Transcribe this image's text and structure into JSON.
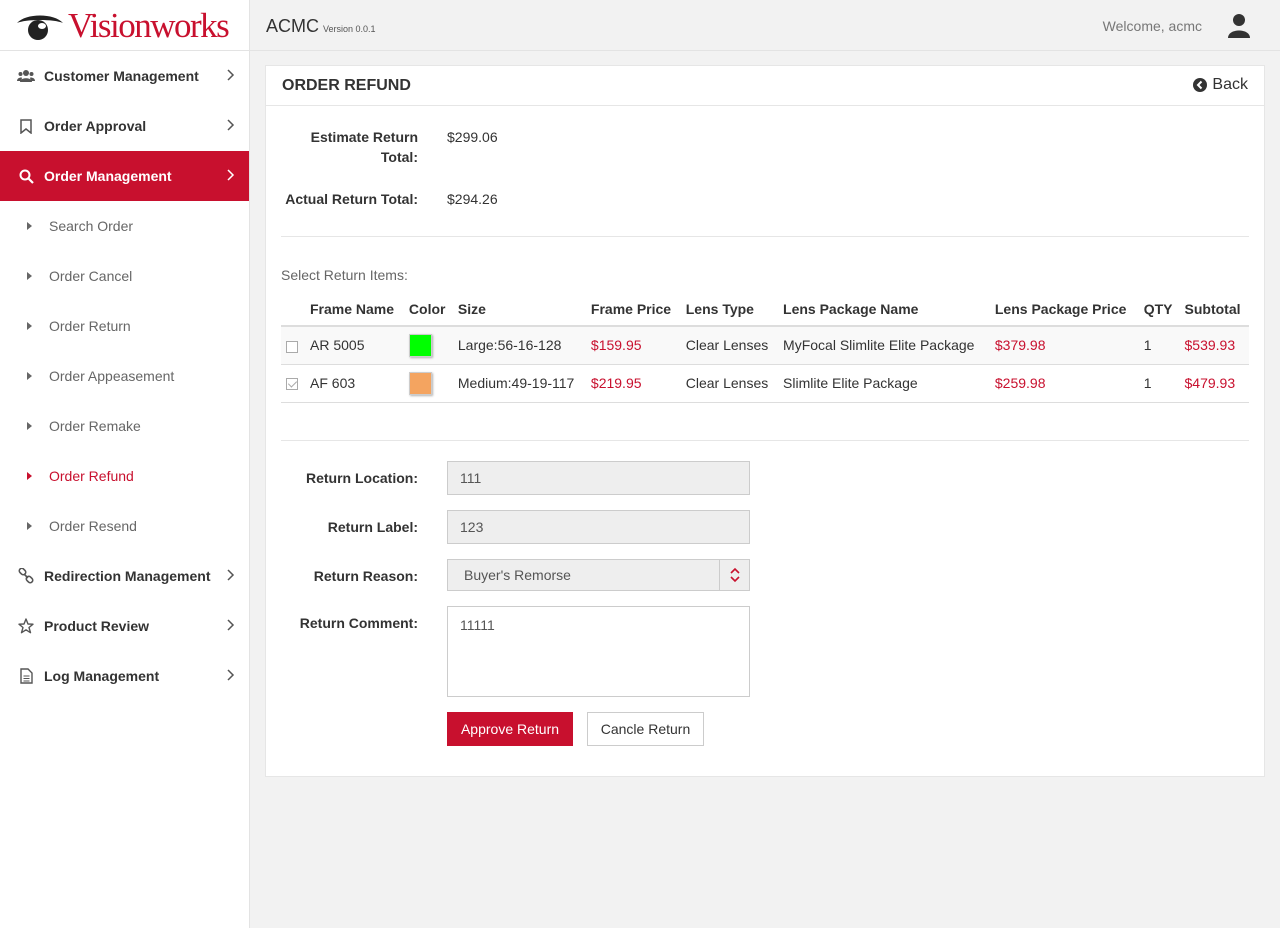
{
  "brand": {
    "logo_text": "Visionworks",
    "accent_color": "#c8102e"
  },
  "topbar": {
    "app_name": "ACMC",
    "version": "Version 0.0.1",
    "welcome": "Welcome, acmc"
  },
  "sidebar": {
    "menu": [
      {
        "label": "Customer Management",
        "icon": "users-icon"
      },
      {
        "label": "Order Approval",
        "icon": "bookmark-icon"
      },
      {
        "label": "Order Management",
        "icon": "search-icon",
        "active": true
      }
    ],
    "submenu": [
      {
        "label": "Search Order"
      },
      {
        "label": "Order Cancel"
      },
      {
        "label": "Order Return"
      },
      {
        "label": "Order Appeasement"
      },
      {
        "label": "Order Remake"
      },
      {
        "label": "Order Refund",
        "active": true
      },
      {
        "label": "Order Resend"
      }
    ],
    "menu_bottom": [
      {
        "label": "Redirection Management",
        "icon": "link-icon"
      },
      {
        "label": "Product Review",
        "icon": "star-icon"
      },
      {
        "label": "Log Management",
        "icon": "document-icon"
      }
    ]
  },
  "panel": {
    "title": "ORDER REFUND",
    "back_label": "Back",
    "estimate_label": "Estimate Return Total:",
    "estimate_value": "$299.06",
    "actual_label": "Actual Return Total:",
    "actual_value": "$294.26",
    "select_label": "Select Return Items:",
    "table": {
      "headers": [
        "Frame Name",
        "Color",
        "Size",
        "Frame Price",
        "Lens Type",
        "Lens Package Name",
        "Lens Package Price",
        "QTY",
        "Subtotal"
      ],
      "rows": [
        {
          "checked": false,
          "frame_name": "AR 5005",
          "color": "#00ff00",
          "size": "Large:56-16-128",
          "frame_price": "$159.95",
          "lens_type": "Clear Lenses",
          "lens_package": "MyFocal Slimlite Elite Package",
          "lens_package_price": "$379.98",
          "qty": "1",
          "subtotal": "$539.93"
        },
        {
          "checked": true,
          "frame_name": "AF 603",
          "color": "#f4a460",
          "size": "Medium:49-19-117",
          "frame_price": "$219.95",
          "lens_type": "Clear Lenses",
          "lens_package": "Slimlite Elite Package",
          "lens_package_price": "$259.98",
          "qty": "1",
          "subtotal": "$479.93"
        }
      ]
    },
    "form": {
      "location_label": "Return Location:",
      "location_value": "111",
      "label_label": "Return Label:",
      "label_value": "123",
      "reason_label": "Return Reason:",
      "reason_value": "Buyer's Remorse",
      "comment_label": "Return Comment:",
      "comment_value": "11111",
      "approve_label": "Approve Return",
      "cancel_label": "Cancle Return"
    }
  }
}
